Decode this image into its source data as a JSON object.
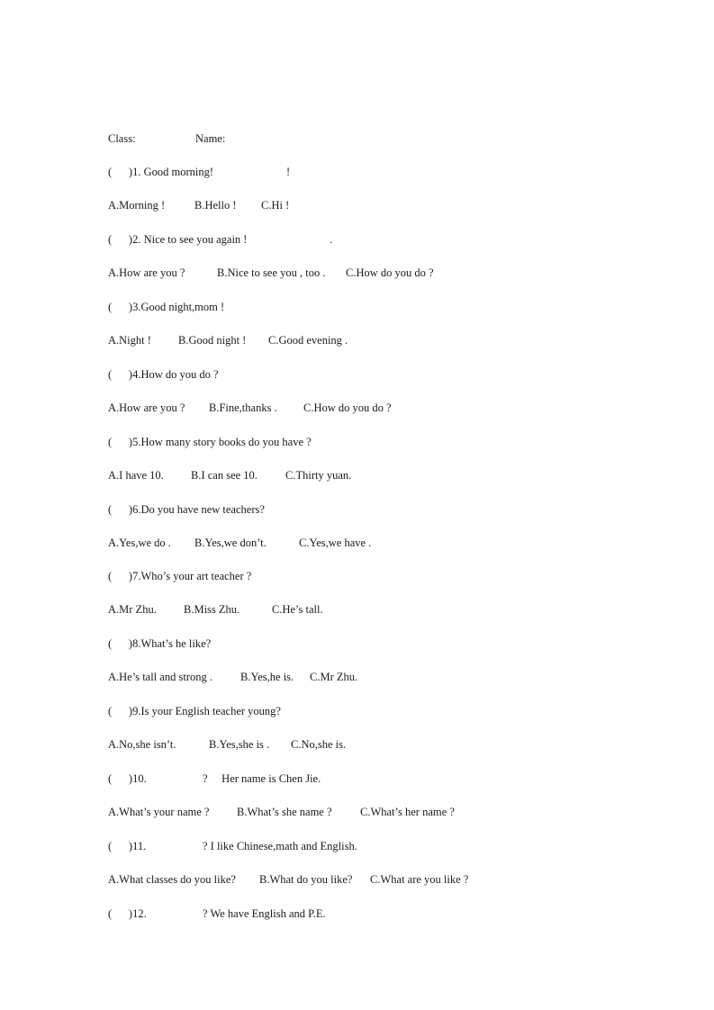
{
  "header": {
    "class_label": "Class:",
    "name_label": "Name:"
  },
  "questions": [
    {
      "prefix": "(      )1. Good morning!",
      "blank_tail": "!",
      "options": [
        "A.Morning !",
        "B.Hello !",
        "C.Hi !"
      ]
    },
    {
      "prefix": "(      )2. Nice to see you again !",
      "blank_tail": ".",
      "options": [
        "A.How are you ?",
        "B.Nice to see you , too .",
        "C.How do you do ?"
      ]
    },
    {
      "prefix": "(      )3.Good night,mom !",
      "blank_tail": "",
      "options": [
        "A.Night !",
        "B.Good night !",
        "C.Good evening ."
      ]
    },
    {
      "prefix": "(      )4.How do you do ?",
      "blank_tail": "",
      "options": [
        "A.How are you ?",
        "B.Fine,thanks .",
        "C.How do you do ?"
      ]
    },
    {
      "prefix": "(      )5.How many story books do you have ?",
      "blank_tail": "",
      "options": [
        "A.I have 10.",
        "B.I can see 10.",
        "C.Thirty yuan."
      ]
    },
    {
      "prefix": "(      )6.Do you have new teachers?",
      "blank_tail": "",
      "options": [
        "A.Yes,we do .",
        "B.Yes,we don’t.",
        "C.Yes,we have ."
      ]
    },
    {
      "prefix": "(      )7.Who’s your art teacher ?",
      "blank_tail": "",
      "options": [
        "A.Mr Zhu.",
        "B.Miss Zhu.",
        "C.He’s tall."
      ]
    },
    {
      "prefix": "(      )8.What’s he like?",
      "blank_tail": "",
      "options": [
        "A.He’s tall and strong .",
        "B.Yes,he is.",
        "C.Mr Zhu."
      ]
    },
    {
      "prefix": "(      )9.Is your English teacher young?",
      "blank_tail": "",
      "options": [
        "A.No,she isn’t.",
        "B.Yes,she is .",
        "C.No,she is."
      ]
    },
    {
      "prefix": "(      )10.",
      "blank_tail": "?     Her name is Chen Jie.",
      "options": [
        "A.What’s your name ?",
        "B.What’s she name ?",
        "C.What’s her name ?"
      ]
    },
    {
      "prefix": "(      )11.",
      "blank_tail": "? I like Chinese,math and English.",
      "options": [
        "A.What classes do you like?",
        "B.What do you like?",
        "C.What are you like ?"
      ]
    },
    {
      "prefix": "(      )12.",
      "blank_tail": "? We have English and P.E.",
      "options": []
    }
  ]
}
